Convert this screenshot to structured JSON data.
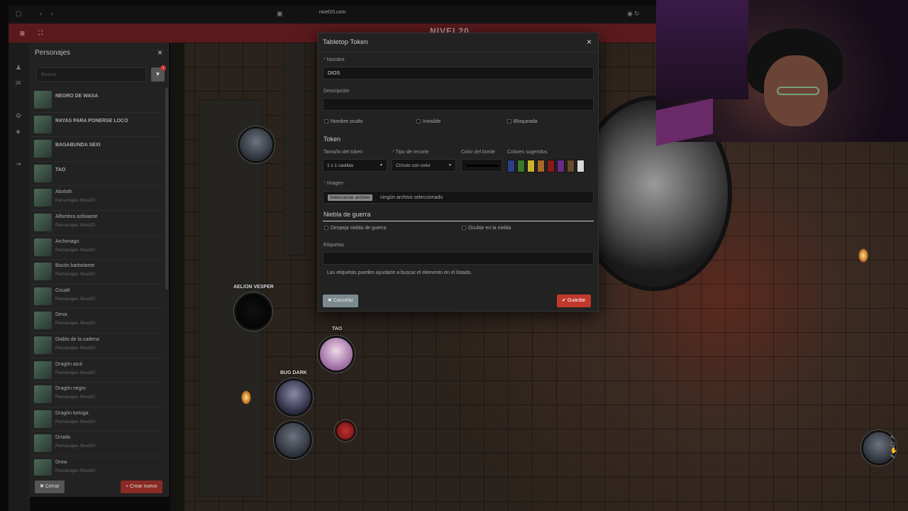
{
  "browser": {
    "url": "nivel20.com"
  },
  "appbar": {
    "logo": "NIVEL20"
  },
  "panel": {
    "title": "Personajes",
    "search_placeholder": "Buscar",
    "filter_badge": "1",
    "items": [
      {
        "name": "NEGRO DE WASA",
        "sub": ""
      },
      {
        "name": "RAYAS PARA PONERSE LOCO",
        "sub": ""
      },
      {
        "name": "BAGABUNDA SEXI",
        "sub": ""
      },
      {
        "name": "tao",
        "sub": ""
      },
      {
        "name": "Aboloth",
        "sub": "Personajes Nivel20"
      },
      {
        "name": "Alfombra asfixiante",
        "sub": "Personajes Nivel20"
      },
      {
        "name": "Archimago",
        "sub": "Personajes Nivel20"
      },
      {
        "name": "Bocón barbotante",
        "sub": "Personajes Nivel20"
      },
      {
        "name": "Couatl",
        "sub": "Personajes Nivel20"
      },
      {
        "name": "Deva",
        "sub": "Personajes Nivel20"
      },
      {
        "name": "Diablo de la cadena",
        "sub": "Personajes Nivel20"
      },
      {
        "name": "Dragón azul",
        "sub": "Personajes Nivel20"
      },
      {
        "name": "Dragón negro",
        "sub": "Personajes Nivel20"
      },
      {
        "name": "Dragón tortuga",
        "sub": "Personajes Nivel20"
      },
      {
        "name": "Dríada",
        "sub": "Personajes Nivel20"
      },
      {
        "name": "Drow",
        "sub": "Personajes Nivel20"
      }
    ],
    "close_label": "Cerrar",
    "new_label": "Crear nuevo"
  },
  "map": {
    "tokens": [
      {
        "label": "AELION VESPER"
      },
      {
        "label": "TAO"
      },
      {
        "label": "BUG DARK"
      }
    ]
  },
  "dialog": {
    "title": "Tabletop Token",
    "name_label": "Nombre",
    "name_value": "DIOS",
    "description_label": "Descripción",
    "description_value": "",
    "checks": [
      "Nombre oculto",
      "Invisible",
      "Bloqueada"
    ],
    "token_section": "Token",
    "size_label": "Tamaño del token",
    "size_value": "1 x 1 casillas",
    "crop_label": "Tipo de recorte",
    "crop_value": "Círculo con color",
    "border_label": "Color del borde",
    "border_color": "#000000",
    "suggested_label": "Colores sugeridos",
    "suggested_colors": [
      "#2a3f8a",
      "#3a7a2a",
      "#c8b42a",
      "#a8682a",
      "#8a1a1a",
      "#6a2a8a",
      "#6a4a2a",
      "#d8d8d8"
    ],
    "image_label": "Imagen",
    "file_button": "Seleccionar archivo",
    "file_text": "ningún archivo seleccionado",
    "fog_section": "Niebla de guerra",
    "fog_checks": [
      "Despeja niebla de guerra",
      "Ocultar en la niebla"
    ],
    "tags_label": "Etiquetas",
    "tags_value": "",
    "help_text": "Las etiquetas pueden ayudarte a buscar el elemento en el listado.",
    "cancel_label": "Cancelar",
    "save_label": "Guardar"
  }
}
